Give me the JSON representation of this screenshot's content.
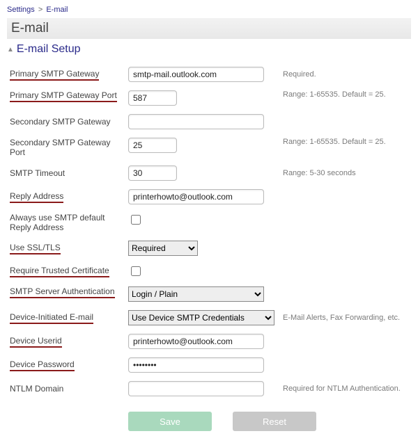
{
  "breadcrumb": {
    "root": "Settings",
    "sep": ">",
    "current": "E-mail"
  },
  "page_title": "E-mail",
  "section_title": "E-mail Setup",
  "rows": {
    "primary_gw": {
      "label": "Primary SMTP Gateway",
      "value": "smtp-mail.outlook.com",
      "hint": "Required."
    },
    "primary_port": {
      "label": "Primary SMTP Gateway Port",
      "value": "587",
      "hint": "Range: 1-65535. Default = 25."
    },
    "secondary_gw": {
      "label": "Secondary SMTP Gateway",
      "value": ""
    },
    "secondary_port": {
      "label": "Secondary SMTP Gateway Port",
      "value": "25",
      "hint": "Range: 1-65535. Default = 25."
    },
    "timeout": {
      "label": "SMTP Timeout",
      "value": "30",
      "hint": "Range: 5-30 seconds"
    },
    "reply": {
      "label": "Reply Address",
      "value": "printerhowto@outlook.com"
    },
    "always_default_reply": {
      "label": "Always use SMTP default Reply Address"
    },
    "use_ssl": {
      "label": "Use SSL/TLS",
      "selected": "Required"
    },
    "trusted_cert": {
      "label": "Require Trusted Certificate"
    },
    "auth": {
      "label": "SMTP Server Authentication",
      "selected": "Login / Plain"
    },
    "dev_init": {
      "label": "Device-Initiated E-mail",
      "selected": "Use Device SMTP Credentials",
      "hint": "E-Mail Alerts, Fax Forwarding, etc."
    },
    "dev_user": {
      "label": "Device Userid",
      "value": "printerhowto@outlook.com"
    },
    "dev_pass": {
      "label": "Device Password",
      "value": "••••••••"
    },
    "ntlm": {
      "label": "NTLM Domain",
      "value": "",
      "hint": "Required for NTLM Authentication."
    }
  },
  "buttons": {
    "save": "Save",
    "reset": "Reset"
  }
}
